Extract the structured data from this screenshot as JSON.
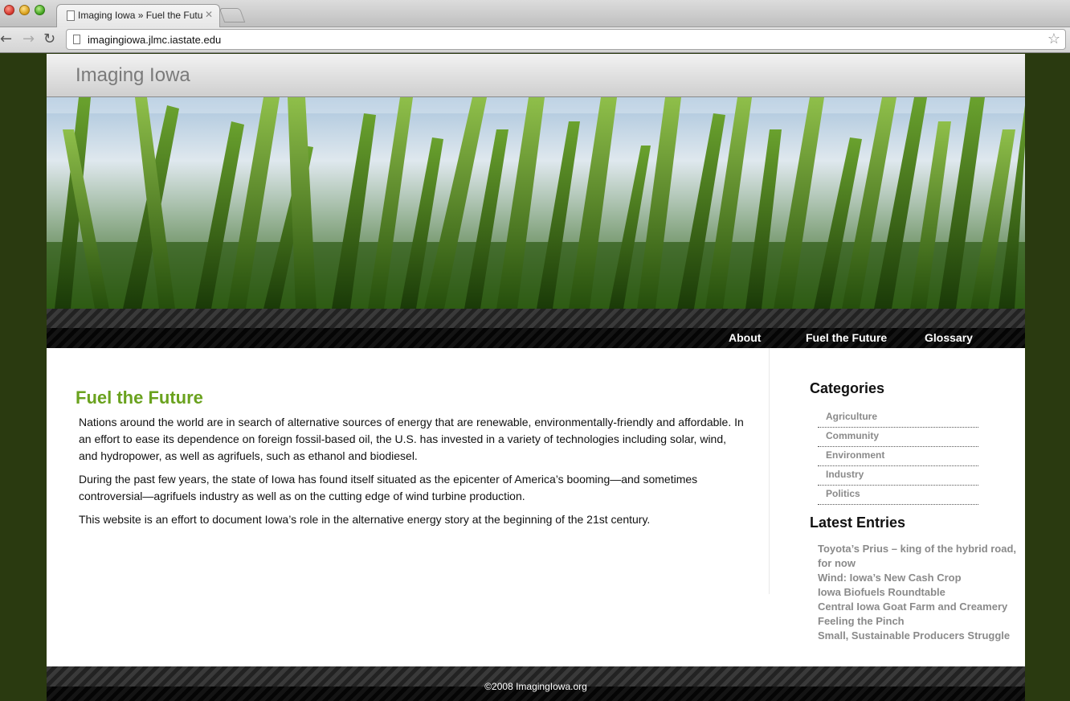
{
  "browser": {
    "tab_title": "Imaging Iowa » Fuel the Futu",
    "tab_close": "✕",
    "url": "imagingiowa.jlmc.iastate.edu"
  },
  "site": {
    "title": "Imaging Iowa"
  },
  "nav": {
    "about": "About",
    "fuel": "Fuel the Future",
    "glossary": "Glossary"
  },
  "post": {
    "title": "Fuel the Future",
    "paragraphs": [
      "Nations around the world are in search of alternative sources of energy that are renewable, environmentally-friendly and affordable. In an effort to ease its dependence on foreign fossil-based oil, the U.S. has invested in a variety of technologies including solar, wind, and hydropower, as well as agrifuels, such as ethanol and biodiesel.",
      "During the past few years, the state of Iowa has found itself situated as the epicenter of America’s booming—and sometimes controversial—agrifuels industry as well as on the cutting edge of wind turbine production.",
      "This website is an effort to document Iowa’s role in the alternative energy story at the beginning of the 21st century."
    ]
  },
  "sidebar": {
    "categories_heading": "Categories",
    "categories": [
      "Agriculture",
      "Community",
      "Environment",
      "Industry",
      "Politics"
    ],
    "latest_heading": "Latest Entries",
    "latest": [
      "Toyota’s Prius – king of the hybrid road, for now",
      "Wind: Iowa’s New Cash Crop",
      "Iowa Biofuels Roundtable",
      "Central Iowa Goat Farm and Creamery",
      "Feeling the Pinch",
      "Small, Sustainable Producers Struggle"
    ]
  },
  "footer": {
    "text": "©2008 ImagingIowa.org"
  }
}
